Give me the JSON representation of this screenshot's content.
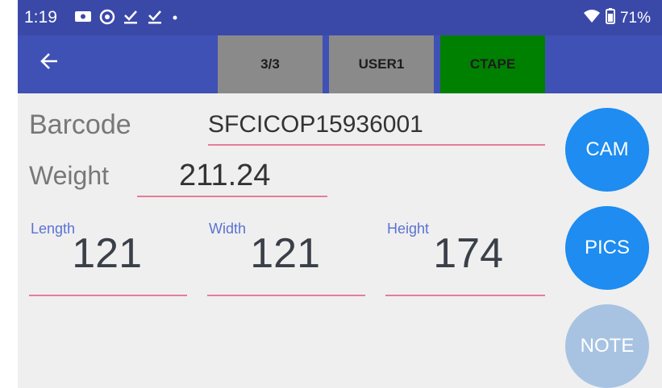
{
  "status_bar": {
    "time": "1:19",
    "battery": "71%",
    "icons": [
      "notification-photo-icon",
      "at-sign-icon",
      "download-check-icon",
      "download-check-icon",
      "dot-icon",
      "wifi-icon",
      "battery-icon"
    ]
  },
  "app_bar": {
    "tabs": [
      "3/3",
      "USER1",
      "CTAPE"
    ],
    "tab_colors": [
      "#8a8a8a",
      "#8a8a8a",
      "#008000"
    ]
  },
  "form": {
    "barcode_label": "Barcode",
    "barcode_value": "SFCICOP15936001",
    "weight_label": "Weight",
    "weight_value": "211.24",
    "length_label": "Length",
    "length_value": "121",
    "width_label": "Width",
    "width_value": "121",
    "height_label": "Height",
    "height_value": "174"
  },
  "buttons": {
    "cam": "CAM",
    "pics": "PICS",
    "note": "NOTE"
  },
  "colors": {
    "status_bar": "#3a49a8",
    "app_bar": "#3f51b5",
    "accent_button": "#1e8cf0",
    "disabled_button": "#a8c3e2",
    "underline": "#e57c9a"
  }
}
